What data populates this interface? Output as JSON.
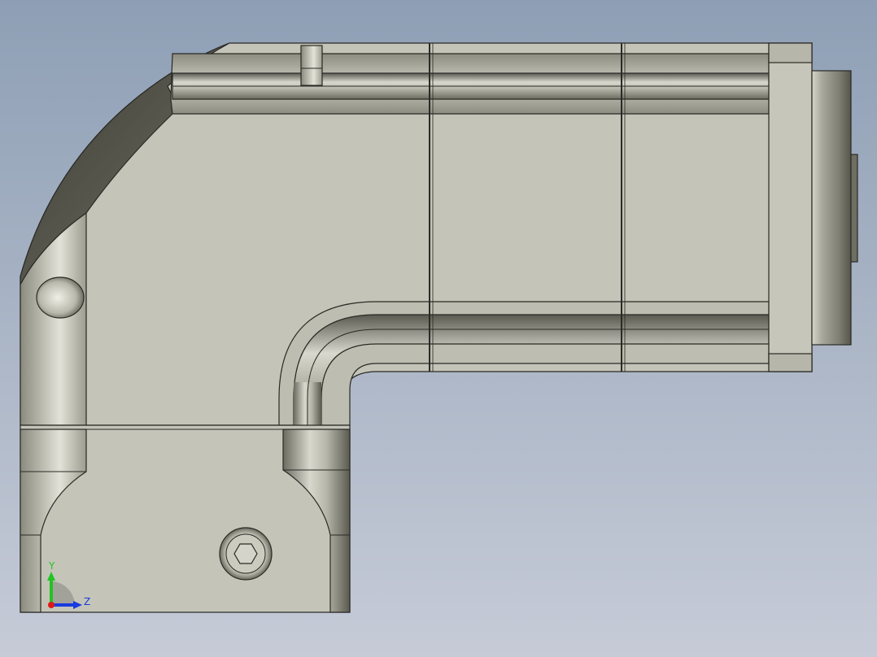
{
  "view": {
    "background_top": "#8e9fb5",
    "background_bottom": "#c6cbd7"
  },
  "model": {
    "face_color": "#c4c4b8",
    "edge_color": "#2a2a26",
    "dark_shade": "#4a4a42"
  },
  "triad": {
    "y_label": "Y",
    "z_label": "Z",
    "y_color": "#22c422",
    "z_color": "#1a3adf",
    "origin_color": "#e01818"
  }
}
